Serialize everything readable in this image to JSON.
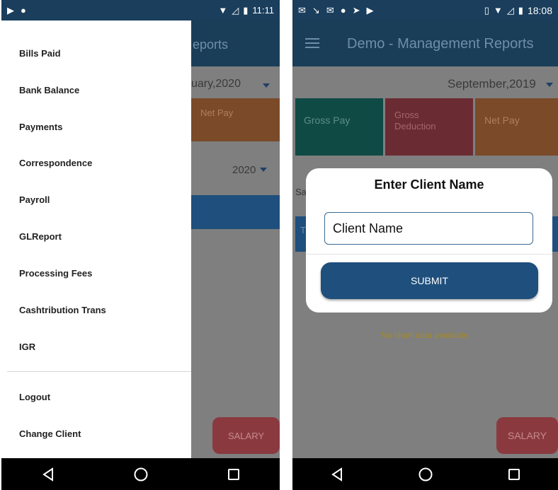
{
  "left_screen": {
    "status": {
      "time": "11:11"
    },
    "appbar": {
      "title_fragment": "eports"
    },
    "month_selector": {
      "value": "uary,2020"
    },
    "tile_net_pay": "Net Pay",
    "year_selector": {
      "value": "2020"
    },
    "drawer": {
      "items": [
        {
          "label": "Bills Paid"
        },
        {
          "label": "Bank Balance"
        },
        {
          "label": "Payments"
        },
        {
          "label": "Correspondence"
        },
        {
          "label": "Payroll"
        },
        {
          "label": "GLReport"
        },
        {
          "label": "Processing Fees"
        },
        {
          "label": "Cashtribution Trans"
        },
        {
          "label": "IGR"
        }
      ],
      "footer_items": [
        {
          "label": "Logout"
        },
        {
          "label": "Change Client"
        }
      ]
    },
    "fab_label": "SALARY"
  },
  "right_screen": {
    "status": {
      "time": "18:08"
    },
    "appbar": {
      "title": "Demo - Management Reports"
    },
    "month_selector": {
      "value": "September,2019"
    },
    "tiles": [
      {
        "label": "Gross Pay",
        "color": "#0f4a45"
      },
      {
        "label": "Gross\nDeduction",
        "color": "#6b2b32"
      },
      {
        "label": "Net Pay",
        "color": "#7a4a29"
      }
    ],
    "partial_label": "Sa",
    "partial_label_2": "T",
    "no_chart_text": "No chart data available.",
    "fab_label": "SALARY",
    "dialog": {
      "title": "Enter Client Name",
      "input_placeholder": "Client Name",
      "submit_label": "SUBMIT"
    }
  },
  "colors": {
    "statusbar": "#1a3e5c",
    "appbar": "#1e4a6f",
    "overlay": "#7f7f7f",
    "submit_button": "#1e4f7d"
  }
}
